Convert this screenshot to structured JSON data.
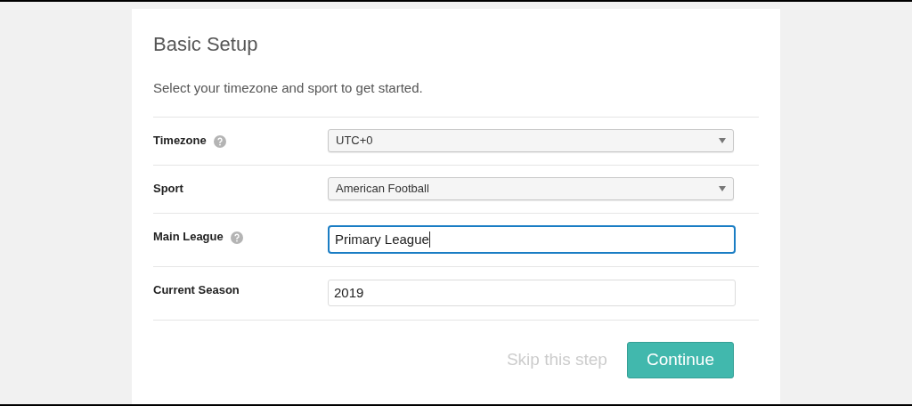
{
  "title": "Basic Setup",
  "intro": "Select your timezone and sport to get started.",
  "fields": [
    {
      "label": "Timezone",
      "help": true,
      "kind": "select",
      "value": "UTC+0"
    },
    {
      "label": "Sport",
      "help": false,
      "kind": "select",
      "value": "American Football"
    },
    {
      "label": "Main League",
      "help": true,
      "kind": "text",
      "value": "Primary League",
      "focused": true
    },
    {
      "label": "Current Season",
      "help": false,
      "kind": "text",
      "value": "2019",
      "focused": false
    }
  ],
  "skip": "Skip this step",
  "continue": "Continue"
}
